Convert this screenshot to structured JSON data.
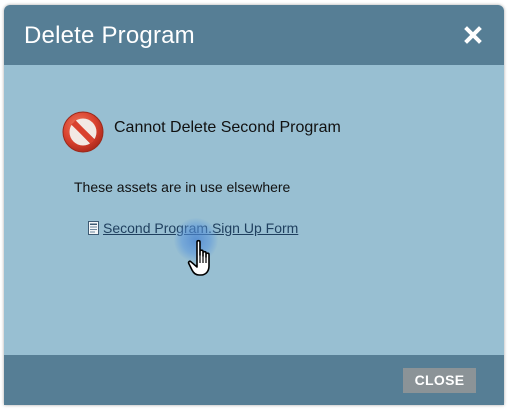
{
  "dialog": {
    "title": "Delete Program",
    "close_icon": "close-x-icon",
    "heading": "Cannot Delete Second Program",
    "heading_icon": "prohibited-icon",
    "message": "These assets are in use elsewhere",
    "assets": [
      {
        "icon": "form-document-icon",
        "label": "Second Program.Sign Up Form"
      }
    ],
    "footer": {
      "close_label": "CLOSE"
    }
  },
  "colors": {
    "header_bg": "#567e95",
    "body_bg": "#98bfd2",
    "button_bg": "#8b9397",
    "link_color": "#1f3f5e",
    "prohibited_red": "#d9412e"
  }
}
